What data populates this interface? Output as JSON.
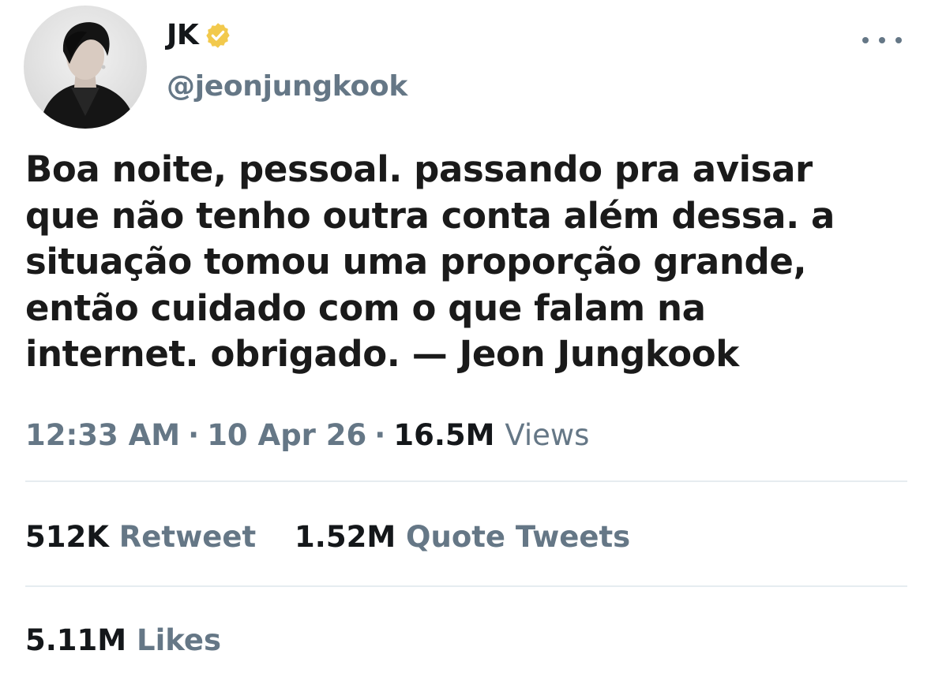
{
  "user": {
    "display_name": "JK",
    "handle": "@jeonjungkook",
    "verified_color": "#F2C94C"
  },
  "tweet": {
    "lines": [
      "Boa noite, pessoal. passando pra avisar",
      "que não tenho outra conta além dessa. a",
      "situação tomou uma proporção grande,",
      "então cuidado com o que falam na",
      "internet. obrigado. — Jeon Jungkook"
    ]
  },
  "meta": {
    "time": "12:33 AM",
    "separator": "·",
    "date": "10 Apr 26",
    "views_count": "16.5M",
    "views_label": "Views"
  },
  "stats": {
    "retweets_count": "512K",
    "retweets_label": "Retweet",
    "quotes_count": "1.52M",
    "quotes_label": "Quote Tweets",
    "likes_count": "5.11M",
    "likes_label": "Likes"
  },
  "icons": {
    "more": "more-options-icon",
    "verified": "verified-badge-icon"
  },
  "colors": {
    "text": "#14171A",
    "secondary": "#657786",
    "divider": "#E6ECF0"
  }
}
